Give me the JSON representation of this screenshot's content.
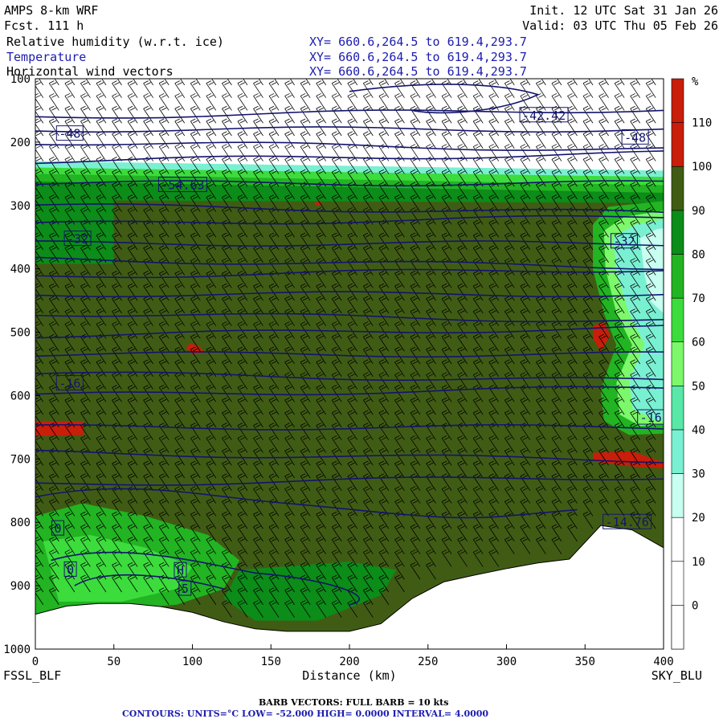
{
  "header": {
    "model": "AMPS 8-km WRF",
    "fcst": "Fcst.  111 h",
    "init": "Init. 12 UTC Sat 31 Jan 26",
    "valid": "Valid: 03 UTC Thu 05 Feb 26",
    "fields": [
      {
        "name": "Relative humidity (w.r.t. ice)",
        "xy": "XY= 660.6,264.5 to 619.4,293.7",
        "color": "#000000"
      },
      {
        "name": "Temperature",
        "xy": "XY= 660.6,264.5 to 619.4,293.7",
        "color": "#1c1cb0"
      },
      {
        "name": "Horizontal wind vectors",
        "xy": "XY= 660.6,264.5 to 619.4,293.7",
        "color": "#000000"
      }
    ]
  },
  "chart_data": {
    "type": "heatmap",
    "title": "Relative humidity (w.r.t. ice), Temperature, Horizontal wind vectors",
    "xlabel": "Distance (km)",
    "ylabel": "",
    "x_range": [
      0,
      400
    ],
    "y_range": [
      1000,
      100
    ],
    "x_ticks": [
      0,
      50,
      100,
      150,
      200,
      250,
      300,
      350,
      400
    ],
    "y_ticks": [
      100,
      200,
      300,
      400,
      500,
      600,
      700,
      800,
      900,
      1000
    ],
    "left_endpoint": "FSSL_BLF",
    "right_endpoint": "SKY_BLU",
    "rh_colorbar": {
      "unit": "%",
      "ticks": [
        0,
        10,
        20,
        30,
        40,
        50,
        60,
        70,
        80,
        90,
        100,
        110
      ],
      "colors": [
        "#ffffff",
        "#ffffff",
        "#ffffff",
        "#c8fff0",
        "#7af0d2",
        "#58e8a8",
        "#7cf86a",
        "#3cdc3c",
        "#22b422",
        "#0c8c18",
        "#405c14",
        "#c81e0a"
      ]
    },
    "temperature_contour_labels": [
      {
        "x": 15,
        "p": 187,
        "label": "-48"
      },
      {
        "x": 375,
        "p": 193,
        "label": "-48"
      },
      {
        "x": 310,
        "p": 158,
        "label": "-42.42"
      },
      {
        "x": 80,
        "p": 268,
        "label": "-54.63"
      },
      {
        "x": 20,
        "p": 353,
        "label": "-32"
      },
      {
        "x": 368,
        "p": 357,
        "label": "-32"
      },
      {
        "x": 15,
        "p": 581,
        "label": "-16"
      },
      {
        "x": 385,
        "p": 635,
        "label": "-16"
      },
      {
        "x": 363,
        "p": 800,
        "label": "-14.76"
      },
      {
        "x": 12,
        "p": 810,
        "label": "0"
      },
      {
        "x": 20,
        "p": 875,
        "label": "0"
      },
      {
        "x": 90,
        "p": 876,
        "label": "H"
      },
      {
        "x": 93,
        "p": 905,
        "label": "5"
      }
    ],
    "terrain_surface_pressure": {
      "x": [
        0,
        20,
        40,
        60,
        80,
        100,
        120,
        140,
        160,
        180,
        200,
        220,
        240,
        260,
        280,
        300,
        320,
        340,
        360,
        380,
        400
      ],
      "p": [
        945,
        932,
        928,
        928,
        933,
        942,
        957,
        968,
        972,
        972,
        972,
        960,
        920,
        894,
        883,
        873,
        864,
        858,
        805,
        812,
        840
      ]
    },
    "barb_vectors": "FULL BARB = 10 kts",
    "contours": {
      "units": "°C",
      "low": "-52.000",
      "high": "0.0000",
      "interval": "4.0000"
    }
  },
  "footer": {
    "barb_line": "BARB VECTORS:  FULL BARB = 10 kts",
    "contour_line": "CONTOURS:  UNITS=°C  LOW= -52.000       HIGH=  0.0000       INTERVAL=   4.0000"
  }
}
